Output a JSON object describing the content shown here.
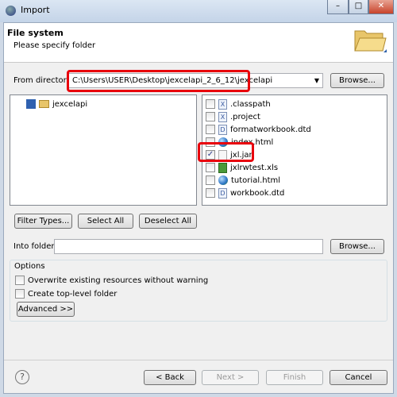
{
  "window": {
    "title": "Import",
    "minimize": "–",
    "maximize": "□",
    "close": "✕"
  },
  "header": {
    "title": "File system",
    "subtitle": "Please specify folder",
    "icon": "folder-open-icon"
  },
  "from_directory": {
    "label": "From directory:",
    "value": "C:\\Users\\USER\\Desktop\\jexcelapi_2_6_12\\jexcelapi",
    "browse": "Browse..."
  },
  "tree": {
    "items": [
      {
        "label": "jexcelapi",
        "checked": false
      }
    ]
  },
  "files": [
    {
      "name": ".classpath",
      "icon": "x",
      "checked": false
    },
    {
      "name": ".project",
      "icon": "x",
      "checked": false
    },
    {
      "name": "formatworkbook.dtd",
      "icon": "d",
      "checked": false
    },
    {
      "name": "index.html",
      "icon": "globe",
      "checked": false
    },
    {
      "name": "jxl.jar",
      "icon": "jar",
      "checked": true
    },
    {
      "name": "jxlrwtest.xls",
      "icon": "xls",
      "checked": false
    },
    {
      "name": "tutorial.html",
      "icon": "globe",
      "checked": false
    },
    {
      "name": "workbook.dtd",
      "icon": "d",
      "checked": false
    }
  ],
  "buttons": {
    "filter": "Filter Types...",
    "select_all": "Select All",
    "deselect_all": "Deselect All"
  },
  "into_folder": {
    "label": "Into folder:",
    "value": "",
    "browse": "Browse..."
  },
  "options": {
    "title": "Options",
    "overwrite": "Overwrite existing resources without warning",
    "create_top": "Create top-level folder",
    "advanced": "Advanced >>"
  },
  "footer": {
    "help": "?",
    "back": "< Back",
    "next": "Next >",
    "finish": "Finish",
    "cancel": "Cancel"
  },
  "colors": {
    "highlight": "#e8000b"
  }
}
